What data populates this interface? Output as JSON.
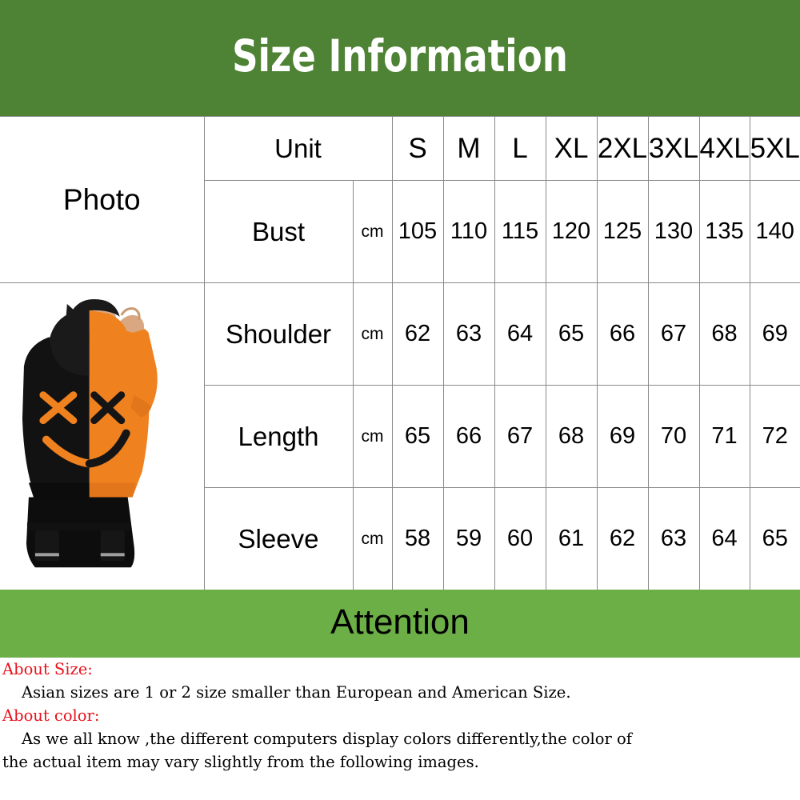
{
  "header": {
    "title": "Size Information",
    "background_color": "#4e8234",
    "text_color": "#ffffff"
  },
  "table": {
    "photo_label": "Photo",
    "unit_header": "Unit",
    "size_headers": [
      "S",
      "M",
      "L",
      "XL",
      "2XL",
      "3XL",
      "4XL",
      "5XL"
    ],
    "unit_value": "cm",
    "rows": [
      {
        "name": "Bust",
        "unit": "cm",
        "values": [
          "105",
          "110",
          "115",
          "120",
          "125",
          "130",
          "135",
          "140"
        ]
      },
      {
        "name": "Shoulder",
        "unit": "cm",
        "values": [
          "62",
          "63",
          "64",
          "65",
          "66",
          "67",
          "68",
          "69"
        ]
      },
      {
        "name": "Length",
        "unit": "cm",
        "values": [
          "65",
          "66",
          "67",
          "68",
          "69",
          "70",
          "71",
          "72"
        ]
      },
      {
        "name": "Sleeve",
        "unit": "cm",
        "values": [
          "58",
          "59",
          "60",
          "61",
          "62",
          "63",
          "64",
          "65"
        ]
      }
    ],
    "photo": {
      "alt": "Man seen from behind wearing a split black and orange hoodie with smiley face graphic",
      "hoodie_color_left": "#121212",
      "hoodie_color_right": "#f0811f",
      "pants_color": "#0d0d0d"
    }
  },
  "attention": {
    "title": "Attention",
    "background_color": "#6caf47",
    "text_color": "#000000"
  },
  "notes": {
    "heading_color": "#e8131c",
    "about_size_heading": "About Size:",
    "about_size_text": "Asian sizes are 1 or 2 size smaller than European and American Size.",
    "about_color_heading": "About color:",
    "about_color_text_line1": "As we all know ,the different computers display colors differently,the color of",
    "about_color_text_line2": "the actual item may vary slightly from the following images."
  }
}
